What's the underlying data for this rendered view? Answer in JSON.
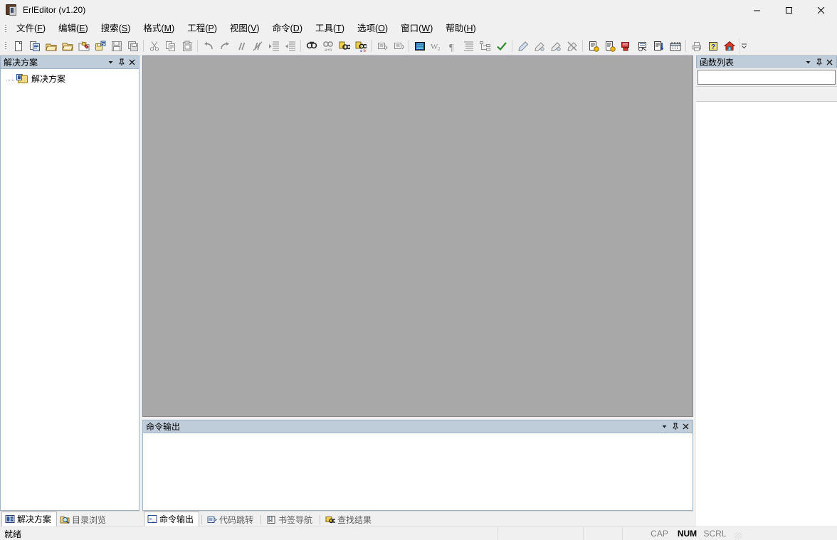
{
  "window": {
    "title": "ErlEditor (v1.20)",
    "icon": "book-icon",
    "minimize_label": "─",
    "maximize_label": "□",
    "close_label": "✕"
  },
  "menubar": {
    "items": [
      {
        "name": "menu-file",
        "text": "文件(F)",
        "label": "文件",
        "accel": "F"
      },
      {
        "name": "menu-edit",
        "text": "编辑(E)",
        "label": "编辑",
        "accel": "E"
      },
      {
        "name": "menu-search",
        "text": "搜索(S)",
        "label": "搜索",
        "accel": "S"
      },
      {
        "name": "menu-format",
        "text": "格式(M)",
        "label": "格式",
        "accel": "M"
      },
      {
        "name": "menu-project",
        "text": "工程(P)",
        "label": "工程",
        "accel": "P"
      },
      {
        "name": "menu-view",
        "text": "视图(V)",
        "label": "视图",
        "accel": "V"
      },
      {
        "name": "menu-command",
        "text": "命令(D)",
        "label": "命令",
        "accel": "D"
      },
      {
        "name": "menu-tools",
        "text": "工具(T)",
        "label": "工具",
        "accel": "T"
      },
      {
        "name": "menu-options",
        "text": "选项(O)",
        "label": "选项",
        "accel": "O"
      },
      {
        "name": "menu-window",
        "text": "窗口(W)",
        "label": "窗口",
        "accel": "W"
      },
      {
        "name": "menu-help",
        "text": "帮助(H)",
        "label": "帮助",
        "accel": "H"
      }
    ]
  },
  "toolbar": {
    "groups": [
      [
        "new-file-icon",
        "new-from-template-icon",
        "open-file-icon",
        "open-folder-icon",
        "open-recent-icon",
        "save-as-icon",
        "save-icon",
        "save-all-icon"
      ],
      [
        "cut-icon",
        "copy-icon",
        "paste-icon"
      ],
      [
        "undo-icon",
        "redo-icon",
        "comment-icon",
        "uncomment-icon",
        "indent-icon",
        "outdent-icon"
      ],
      [
        "find-icon",
        "replace-icon",
        "find-in-files-icon",
        "replace-in-files-icon"
      ],
      [
        "goto-prev-icon",
        "goto-next-icon"
      ],
      [
        "toggle-whitespace-icon",
        "word-wrap-icon",
        "show-paragraph-icon",
        "line-numbers-icon",
        "tree-view-icon",
        "check-syntax-icon"
      ],
      [
        "bookmark-toggle-icon",
        "bookmark-next-icon",
        "bookmark-prev-icon",
        "bookmark-clear-icon"
      ],
      [
        "compile-icon",
        "compile-all-icon",
        "run-icon",
        "debug-icon",
        "export-icon",
        "calendar-icon"
      ],
      [
        "print-icon",
        "help-icon",
        "home-icon"
      ]
    ],
    "overflow_label": "▼"
  },
  "left_dock": {
    "pane": {
      "title": "解决方案",
      "menu_button": "chevron-down-icon",
      "pin_button": "pin-icon",
      "close_button": "close-icon",
      "tree": [
        {
          "label": "解决方案",
          "icon": "solution-folder-icon"
        }
      ]
    },
    "tabs": [
      {
        "label": "解决方案",
        "icon": "solution-icon",
        "active": true
      },
      {
        "label": "目录浏览",
        "icon": "folder-browse-icon",
        "active": false
      }
    ]
  },
  "editor": {
    "name": "editor-client-area",
    "background": "#a8a8a8",
    "content": ""
  },
  "output_pane": {
    "title": "命令输出",
    "menu_button": "chevron-down-icon",
    "pin_button": "pin-icon",
    "close_button": "close-icon",
    "content": "",
    "tabs": [
      {
        "label": "命令输出",
        "icon": "console-icon",
        "active": true
      },
      {
        "label": "代码跳转",
        "icon": "code-jump-icon",
        "active": false
      },
      {
        "label": "书签导航",
        "icon": "bookmark-nav-icon",
        "active": false
      },
      {
        "label": "查找结果",
        "icon": "find-results-icon",
        "active": false
      }
    ]
  },
  "right_dock": {
    "pane": {
      "title": "函数列表",
      "menu_button": "chevron-down-icon",
      "pin_button": "pin-icon",
      "close_button": "close-icon",
      "search_value": "",
      "search_placeholder": ""
    }
  },
  "statusbar": {
    "message": "就绪",
    "cells": [
      "",
      "",
      ""
    ],
    "indicators": [
      {
        "label": "CAP",
        "active": false
      },
      {
        "label": "NUM",
        "active": true
      },
      {
        "label": "SCRL",
        "active": false
      }
    ]
  },
  "colors": {
    "caption_bg": "#bfcddb",
    "caption_border": "#9fb3c6",
    "chrome_bg": "#f0f0f0",
    "editor_bg": "#a8a8a8",
    "accent_text": "#000000"
  }
}
